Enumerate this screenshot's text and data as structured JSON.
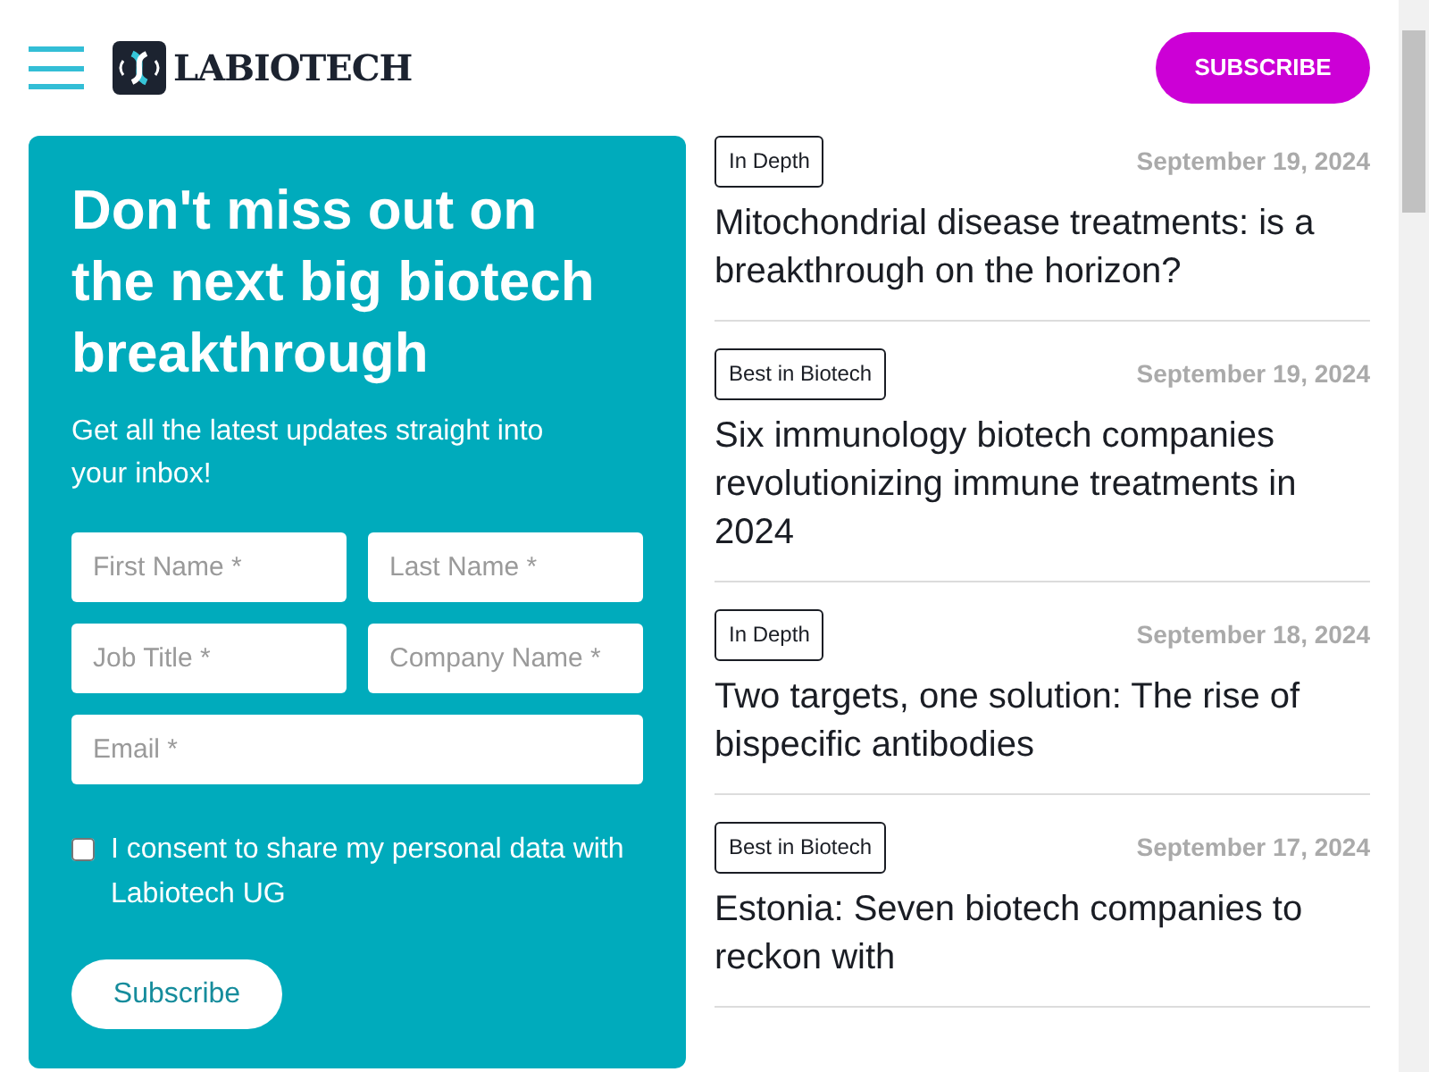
{
  "header": {
    "logo_text": "LABIOTECH",
    "subscribe_button": "SUBSCRIBE"
  },
  "signup": {
    "heading": "Don't miss out on the next big biotech breakthrough",
    "subheading": "Get all the latest updates straight into your inbox!",
    "fields": [
      {
        "placeholder": "First Name *",
        "half": true
      },
      {
        "placeholder": "Last Name *",
        "half": true
      },
      {
        "placeholder": "Job Title *",
        "half": true
      },
      {
        "placeholder": "Company Name *",
        "half": true
      },
      {
        "placeholder": "Email *",
        "half": false
      }
    ],
    "consent": {
      "label": "I consent to share my personal data with Labiotech UG",
      "checked": false
    },
    "button": "Subscribe"
  },
  "articles": [
    {
      "tag": "In Depth",
      "date": "September 19, 2024",
      "title": "Mitochondrial disease treatments: is a breakthrough on the horizon?"
    },
    {
      "tag": "Best in Biotech",
      "date": "September 19, 2024",
      "title": "Six immunology biotech companies revolutionizing immune treatments in 2024"
    },
    {
      "tag": "In Depth",
      "date": "September 18, 2024",
      "title": "Two targets, one solution: The rise of bispecific antibodies"
    },
    {
      "tag": "Best in Biotech",
      "date": "September 17, 2024",
      "title": "Estonia: Seven biotech companies to reckon with"
    }
  ]
}
